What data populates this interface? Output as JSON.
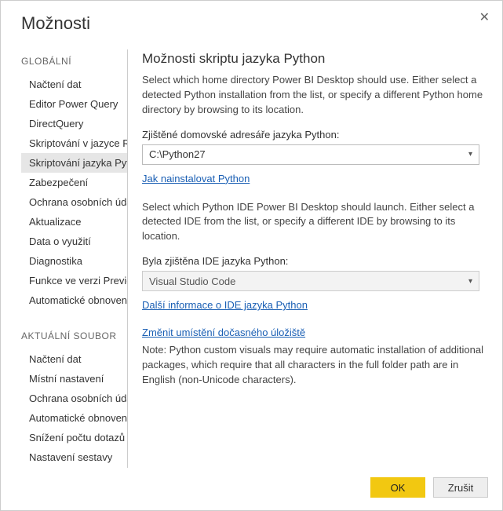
{
  "window": {
    "title": "Možnosti"
  },
  "sidebar": {
    "section1": {
      "header": "GLOBÁLNÍ",
      "items": [
        "Načtení dat",
        "Editor Power Query",
        "DirectQuery",
        "Skriptování v jazyce R",
        "Skriptování jazyka Python",
        "Zabezpečení",
        "Ochrana osobních údajů",
        "Aktualizace",
        "Data o využití",
        "Diagnostika",
        "Funkce ve verzi Preview",
        "Automatické obnovení"
      ],
      "selected_index": 4
    },
    "section2": {
      "header": "AKTUÁLNÍ SOUBOR",
      "items": [
        "Načtení dat",
        "Místní nastavení",
        "Ochrana osobních údajů",
        "Automatické obnovení",
        "Snížení počtu dotazů",
        "Nastavení sestavy"
      ]
    }
  },
  "main": {
    "heading": "Možnosti skriptu jazyka Python",
    "intro": "Select which home directory Power BI Desktop should use. Either select a detected Python installation from the list, or specify a different Python home directory by browsing to its location.",
    "home_label": "Zjištěné domovské adresáře jazyka Python:",
    "home_value": "C:\\Python27",
    "install_link": "Jak nainstalovat Python",
    "ide_intro": "Select which Python IDE Power BI Desktop should launch. Either select a detected IDE from the list, or specify a different IDE by browsing to its location.",
    "ide_label": "Byla zjištěna IDE jazyka Python:",
    "ide_value": "Visual Studio Code",
    "ide_link": "Další informace o IDE jazyka Python",
    "temp_link": "Změnit umístění dočasného úložiště",
    "note": "Note: Python custom visuals may require automatic installation of additional packages, which require that all characters in the full folder path are in English (non-Unicode characters)."
  },
  "footer": {
    "ok": "OK",
    "cancel": "Zrušit"
  }
}
